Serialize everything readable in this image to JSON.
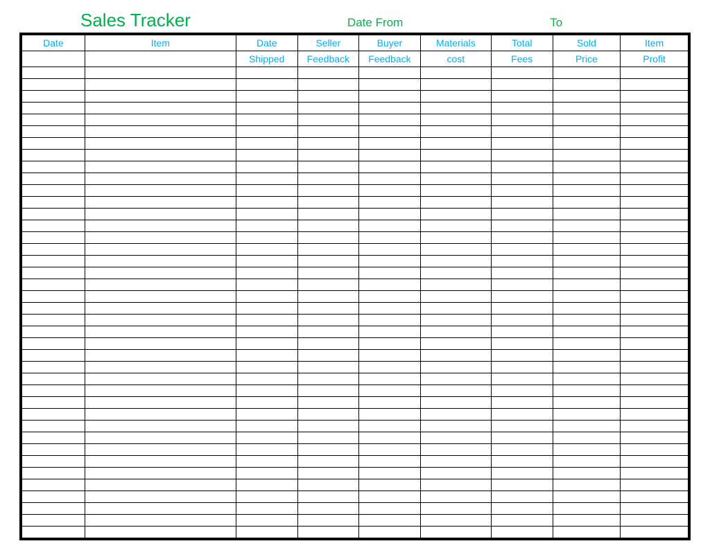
{
  "header": {
    "title": "Sales Tracker",
    "date_from_label": "Date From",
    "to_label": "To"
  },
  "columns": [
    {
      "line1": "Date",
      "line2": ""
    },
    {
      "line1": "Item",
      "line2": ""
    },
    {
      "line1": "Date",
      "line2": "Shipped"
    },
    {
      "line1": "Seller",
      "line2": "Feedback"
    },
    {
      "line1": "Buyer",
      "line2": "Feedback"
    },
    {
      "line1": "Materials",
      "line2": "cost"
    },
    {
      "line1": "Total",
      "line2": "Fees"
    },
    {
      "line1": "Sold",
      "line2": "Price"
    },
    {
      "line1": "Item",
      "line2": "Profit"
    }
  ],
  "row_count": 40,
  "colors": {
    "title_green": "#00b04f",
    "header_blue": "#00afef",
    "grid_black": "#000000"
  }
}
